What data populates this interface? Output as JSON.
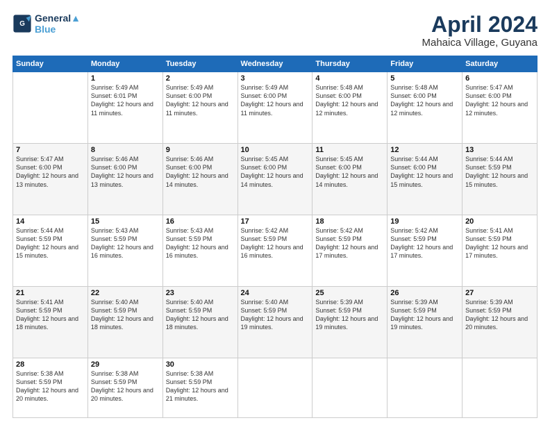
{
  "header": {
    "logo_line1": "General",
    "logo_line2": "Blue",
    "month": "April 2024",
    "location": "Mahaica Village, Guyana"
  },
  "weekdays": [
    "Sunday",
    "Monday",
    "Tuesday",
    "Wednesday",
    "Thursday",
    "Friday",
    "Saturday"
  ],
  "weeks": [
    [
      {
        "day": "",
        "sunrise": "",
        "sunset": "",
        "daylight": ""
      },
      {
        "day": "1",
        "sunrise": "Sunrise: 5:49 AM",
        "sunset": "Sunset: 6:01 PM",
        "daylight": "Daylight: 12 hours and 11 minutes."
      },
      {
        "day": "2",
        "sunrise": "Sunrise: 5:49 AM",
        "sunset": "Sunset: 6:00 PM",
        "daylight": "Daylight: 12 hours and 11 minutes."
      },
      {
        "day": "3",
        "sunrise": "Sunrise: 5:49 AM",
        "sunset": "Sunset: 6:00 PM",
        "daylight": "Daylight: 12 hours and 11 minutes."
      },
      {
        "day": "4",
        "sunrise": "Sunrise: 5:48 AM",
        "sunset": "Sunset: 6:00 PM",
        "daylight": "Daylight: 12 hours and 12 minutes."
      },
      {
        "day": "5",
        "sunrise": "Sunrise: 5:48 AM",
        "sunset": "Sunset: 6:00 PM",
        "daylight": "Daylight: 12 hours and 12 minutes."
      },
      {
        "day": "6",
        "sunrise": "Sunrise: 5:47 AM",
        "sunset": "Sunset: 6:00 PM",
        "daylight": "Daylight: 12 hours and 12 minutes."
      }
    ],
    [
      {
        "day": "7",
        "sunrise": "Sunrise: 5:47 AM",
        "sunset": "Sunset: 6:00 PM",
        "daylight": "Daylight: 12 hours and 13 minutes."
      },
      {
        "day": "8",
        "sunrise": "Sunrise: 5:46 AM",
        "sunset": "Sunset: 6:00 PM",
        "daylight": "Daylight: 12 hours and 13 minutes."
      },
      {
        "day": "9",
        "sunrise": "Sunrise: 5:46 AM",
        "sunset": "Sunset: 6:00 PM",
        "daylight": "Daylight: 12 hours and 14 minutes."
      },
      {
        "day": "10",
        "sunrise": "Sunrise: 5:45 AM",
        "sunset": "Sunset: 6:00 PM",
        "daylight": "Daylight: 12 hours and 14 minutes."
      },
      {
        "day": "11",
        "sunrise": "Sunrise: 5:45 AM",
        "sunset": "Sunset: 6:00 PM",
        "daylight": "Daylight: 12 hours and 14 minutes."
      },
      {
        "day": "12",
        "sunrise": "Sunrise: 5:44 AM",
        "sunset": "Sunset: 6:00 PM",
        "daylight": "Daylight: 12 hours and 15 minutes."
      },
      {
        "day": "13",
        "sunrise": "Sunrise: 5:44 AM",
        "sunset": "Sunset: 5:59 PM",
        "daylight": "Daylight: 12 hours and 15 minutes."
      }
    ],
    [
      {
        "day": "14",
        "sunrise": "Sunrise: 5:44 AM",
        "sunset": "Sunset: 5:59 PM",
        "daylight": "Daylight: 12 hours and 15 minutes."
      },
      {
        "day": "15",
        "sunrise": "Sunrise: 5:43 AM",
        "sunset": "Sunset: 5:59 PM",
        "daylight": "Daylight: 12 hours and 16 minutes."
      },
      {
        "day": "16",
        "sunrise": "Sunrise: 5:43 AM",
        "sunset": "Sunset: 5:59 PM",
        "daylight": "Daylight: 12 hours and 16 minutes."
      },
      {
        "day": "17",
        "sunrise": "Sunrise: 5:42 AM",
        "sunset": "Sunset: 5:59 PM",
        "daylight": "Daylight: 12 hours and 16 minutes."
      },
      {
        "day": "18",
        "sunrise": "Sunrise: 5:42 AM",
        "sunset": "Sunset: 5:59 PM",
        "daylight": "Daylight: 12 hours and 17 minutes."
      },
      {
        "day": "19",
        "sunrise": "Sunrise: 5:42 AM",
        "sunset": "Sunset: 5:59 PM",
        "daylight": "Daylight: 12 hours and 17 minutes."
      },
      {
        "day": "20",
        "sunrise": "Sunrise: 5:41 AM",
        "sunset": "Sunset: 5:59 PM",
        "daylight": "Daylight: 12 hours and 17 minutes."
      }
    ],
    [
      {
        "day": "21",
        "sunrise": "Sunrise: 5:41 AM",
        "sunset": "Sunset: 5:59 PM",
        "daylight": "Daylight: 12 hours and 18 minutes."
      },
      {
        "day": "22",
        "sunrise": "Sunrise: 5:40 AM",
        "sunset": "Sunset: 5:59 PM",
        "daylight": "Daylight: 12 hours and 18 minutes."
      },
      {
        "day": "23",
        "sunrise": "Sunrise: 5:40 AM",
        "sunset": "Sunset: 5:59 PM",
        "daylight": "Daylight: 12 hours and 18 minutes."
      },
      {
        "day": "24",
        "sunrise": "Sunrise: 5:40 AM",
        "sunset": "Sunset: 5:59 PM",
        "daylight": "Daylight: 12 hours and 19 minutes."
      },
      {
        "day": "25",
        "sunrise": "Sunrise: 5:39 AM",
        "sunset": "Sunset: 5:59 PM",
        "daylight": "Daylight: 12 hours and 19 minutes."
      },
      {
        "day": "26",
        "sunrise": "Sunrise: 5:39 AM",
        "sunset": "Sunset: 5:59 PM",
        "daylight": "Daylight: 12 hours and 19 minutes."
      },
      {
        "day": "27",
        "sunrise": "Sunrise: 5:39 AM",
        "sunset": "Sunset: 5:59 PM",
        "daylight": "Daylight: 12 hours and 20 minutes."
      }
    ],
    [
      {
        "day": "28",
        "sunrise": "Sunrise: 5:38 AM",
        "sunset": "Sunset: 5:59 PM",
        "daylight": "Daylight: 12 hours and 20 minutes."
      },
      {
        "day": "29",
        "sunrise": "Sunrise: 5:38 AM",
        "sunset": "Sunset: 5:59 PM",
        "daylight": "Daylight: 12 hours and 20 minutes."
      },
      {
        "day": "30",
        "sunrise": "Sunrise: 5:38 AM",
        "sunset": "Sunset: 5:59 PM",
        "daylight": "Daylight: 12 hours and 21 minutes."
      },
      {
        "day": "",
        "sunrise": "",
        "sunset": "",
        "daylight": ""
      },
      {
        "day": "",
        "sunrise": "",
        "sunset": "",
        "daylight": ""
      },
      {
        "day": "",
        "sunrise": "",
        "sunset": "",
        "daylight": ""
      },
      {
        "day": "",
        "sunrise": "",
        "sunset": "",
        "daylight": ""
      }
    ]
  ]
}
